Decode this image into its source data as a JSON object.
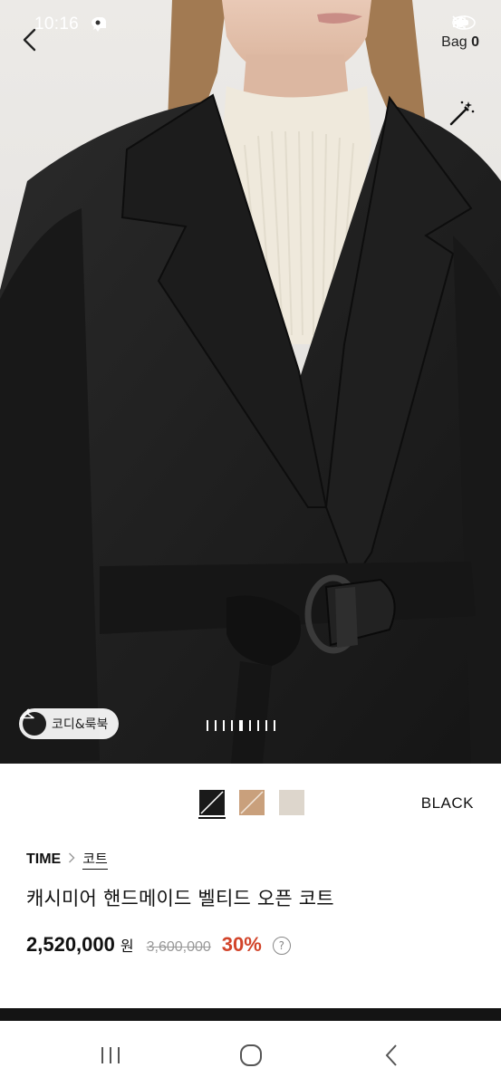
{
  "status_bar": {
    "time": "10:16",
    "icons": [
      "chat-icon",
      "cloud-icon",
      "location-icon",
      "mute-icon",
      "wifi-icon",
      "signal-icon",
      "battery-icon"
    ]
  },
  "header": {
    "bag_label": "Bag",
    "bag_count": "0"
  },
  "image": {
    "lookbook_label": "코디&룩북",
    "page_count": 9,
    "active_page": 5
  },
  "colors": {
    "selected_name": "BLACK",
    "swatches": [
      {
        "name": "black",
        "color": "#1a1a1a",
        "selected": true
      },
      {
        "name": "camel",
        "color": "#c9a07c",
        "selected": false
      },
      {
        "name": "beige",
        "color": "#ddd6cc",
        "selected": false
      }
    ]
  },
  "product": {
    "brand": "TIME",
    "category": "코트",
    "title": "캐시미어 핸드메이드 벨티드 오픈 코트",
    "price": "2,520,000",
    "currency": "원",
    "original_price": "3,600,000",
    "discount": "30%",
    "help_symbol": "?"
  },
  "theme": {
    "accent_discount": "#d2442a",
    "text": "#111111",
    "muted": "#999999"
  }
}
